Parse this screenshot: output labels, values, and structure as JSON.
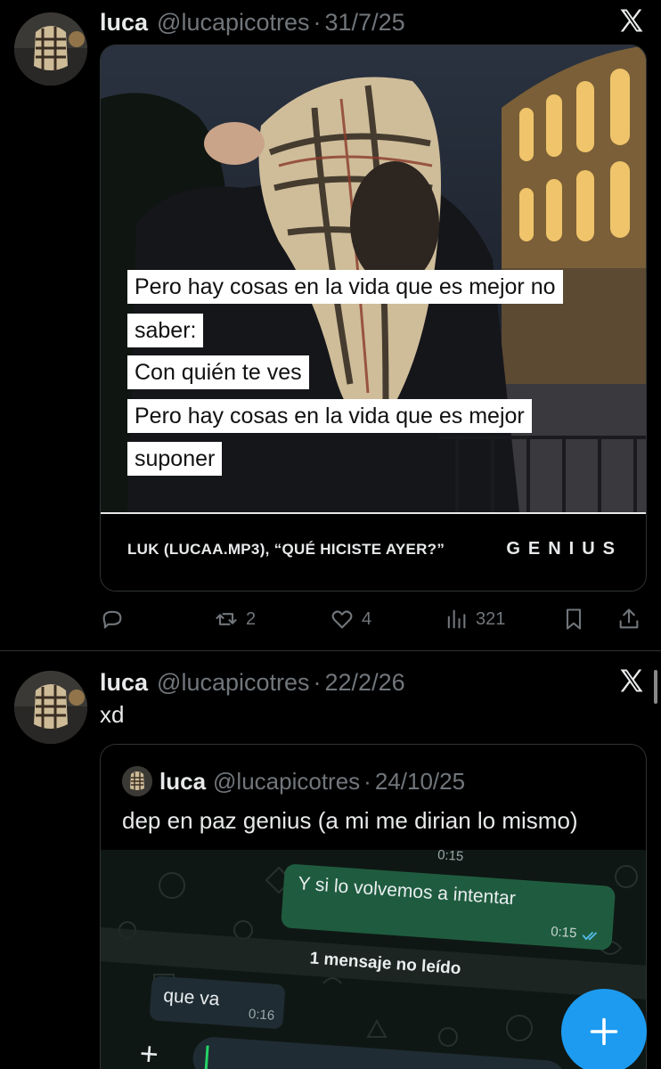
{
  "tweets": [
    {
      "author_name": "luca",
      "handle": "@lucapicotres",
      "separator": "·",
      "date": "31/7/25",
      "card": {
        "lyrics": [
          "Pero hay cosas en la vida que es mejor no",
          "saber:",
          "Con quién te ves",
          "Pero hay cosas en la vida que es mejor",
          "suponer"
        ],
        "song_credit": "LUK (LUCAA.MP3), “QUÉ HICISTE AYER?”",
        "brand": "GENIUS"
      },
      "actions": {
        "reply_icon": "reply-icon",
        "retweets": "2",
        "likes": "4",
        "views": "321",
        "bookmark_icon": "bookmark-icon",
        "share_icon": "share-icon"
      }
    },
    {
      "author_name": "luca",
      "handle": "@lucapicotres",
      "separator": "·",
      "date": "22/2/26",
      "text": "xd",
      "quote": {
        "author_name": "luca",
        "handle": "@lucapicotres",
        "separator": "·",
        "date": "24/10/25",
        "text": "dep en paz genius (a mi me dirian lo mismo)",
        "chat": {
          "top_time": "0:15",
          "outgoing_text": "Y si lo volvemos a intentar",
          "outgoing_time": "0:15",
          "unread_label": "1 mensaje no leído",
          "incoming_text": "que va",
          "incoming_time": "0:16",
          "plus": "+"
        }
      }
    }
  ],
  "colors": {
    "background": "#000000",
    "text_primary": "#e7e9ea",
    "text_secondary": "#71767b",
    "border": "#2f3336",
    "accent": "#1d9bf0",
    "whatsapp_out": "#1f5c3f"
  },
  "icons": {
    "x_logo": "x-logo-icon",
    "fab": "plus-icon"
  }
}
